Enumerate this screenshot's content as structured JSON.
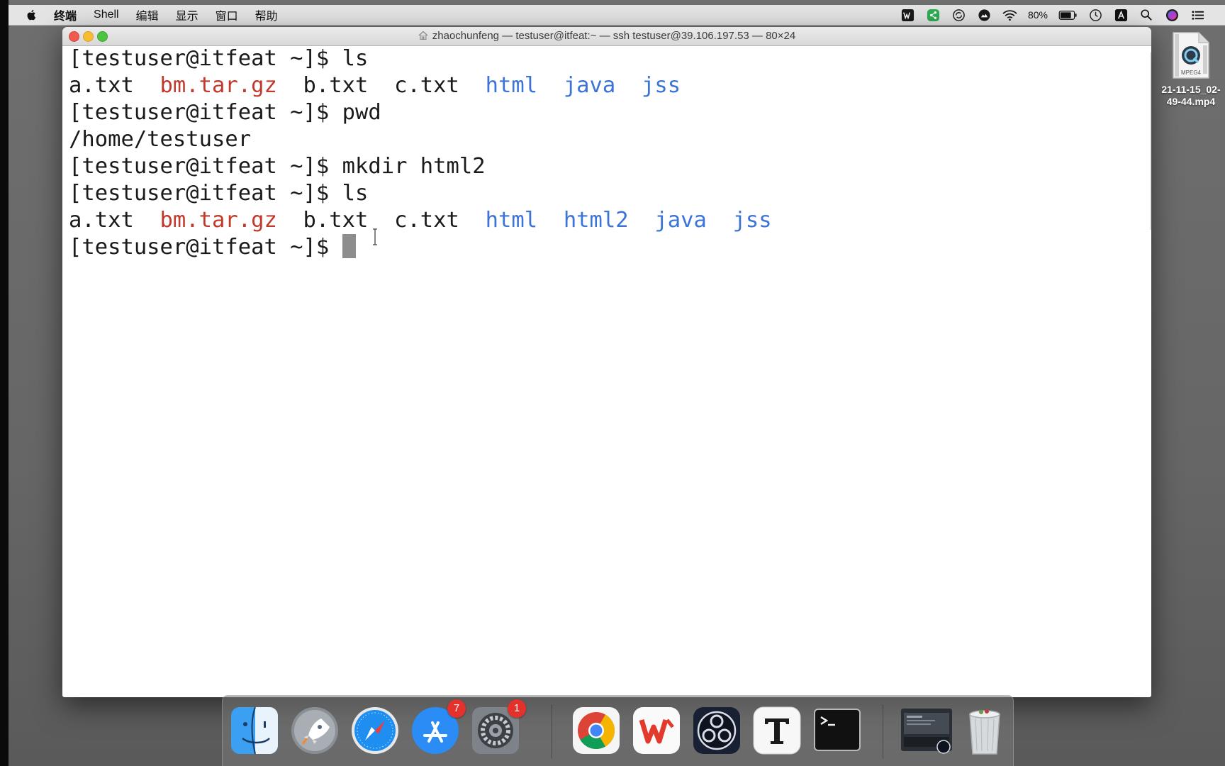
{
  "menubar": {
    "app_name": "终端",
    "items": [
      "Shell",
      "编辑",
      "显示",
      "窗口",
      "帮助"
    ],
    "battery_percent": "80%",
    "status_icons": [
      "wps-icon",
      "share-icon",
      "sync-icon",
      "drive-icon",
      "wifi-icon",
      "battery-icon",
      "clock-icon",
      "input-method-icon",
      "spotlight-search-icon",
      "siri-icon",
      "notification-center-icon"
    ]
  },
  "terminal": {
    "title": "zhaochunfeng — testuser@itfeat:~ — ssh testuser@39.106.197.53 — 80×24",
    "colors": {
      "text": "#1a1a1a",
      "archive": "#c0392b",
      "directory": "#3b74d6",
      "cursor": "#8d8d8d"
    },
    "lines": [
      {
        "segments": [
          {
            "text": "[testuser@itfeat ~]$ ls",
            "color": "plain"
          }
        ]
      },
      {
        "segments": [
          {
            "text": "a.txt  ",
            "color": "plain"
          },
          {
            "text": "bm.tar.gz",
            "color": "red"
          },
          {
            "text": "  b.txt  c.txt  ",
            "color": "plain"
          },
          {
            "text": "html",
            "color": "blue"
          },
          {
            "text": "  ",
            "color": "plain"
          },
          {
            "text": "java",
            "color": "blue"
          },
          {
            "text": "  ",
            "color": "plain"
          },
          {
            "text": "jss",
            "color": "blue"
          }
        ]
      },
      {
        "segments": [
          {
            "text": "[testuser@itfeat ~]$ pwd",
            "color": "plain"
          }
        ]
      },
      {
        "segments": [
          {
            "text": "/home/testuser",
            "color": "plain"
          }
        ]
      },
      {
        "segments": [
          {
            "text": "[testuser@itfeat ~]$ mkdir html2",
            "color": "plain"
          }
        ]
      },
      {
        "segments": [
          {
            "text": "[testuser@itfeat ~]$ ls",
            "color": "plain"
          }
        ]
      },
      {
        "segments": [
          {
            "text": "a.txt  ",
            "color": "plain"
          },
          {
            "text": "bm.tar.gz",
            "color": "red"
          },
          {
            "text": "  b.txt  c.txt  ",
            "color": "plain"
          },
          {
            "text": "html",
            "color": "blue"
          },
          {
            "text": "  ",
            "color": "plain"
          },
          {
            "text": "html2",
            "color": "blue"
          },
          {
            "text": "  ",
            "color": "plain"
          },
          {
            "text": "java",
            "color": "blue"
          },
          {
            "text": "  ",
            "color": "plain"
          },
          {
            "text": "jss",
            "color": "blue"
          }
        ]
      },
      {
        "segments": [
          {
            "text": "[testuser@itfeat ~]$ ",
            "color": "plain"
          }
        ],
        "cursor": true
      }
    ]
  },
  "desktop": {
    "file_icon_label": "MPEG4",
    "file_name_line1": "21-11-15_02-",
    "file_name_line2": "49-44.mp4"
  },
  "dock": {
    "apps": [
      {
        "name": "finder",
        "badge": null
      },
      {
        "name": "launchpad",
        "badge": null
      },
      {
        "name": "safari",
        "badge": null
      },
      {
        "name": "app-store",
        "badge": "7"
      },
      {
        "name": "system-preferences",
        "badge": "1"
      },
      {
        "name": "chrome",
        "badge": null
      },
      {
        "name": "wps-office",
        "badge": null
      },
      {
        "name": "obs",
        "badge": null
      },
      {
        "name": "typora",
        "badge": null
      },
      {
        "name": "terminal",
        "badge": null
      },
      {
        "name": "screenshot-stack",
        "badge": null
      },
      {
        "name": "trash",
        "badge": null
      }
    ]
  }
}
